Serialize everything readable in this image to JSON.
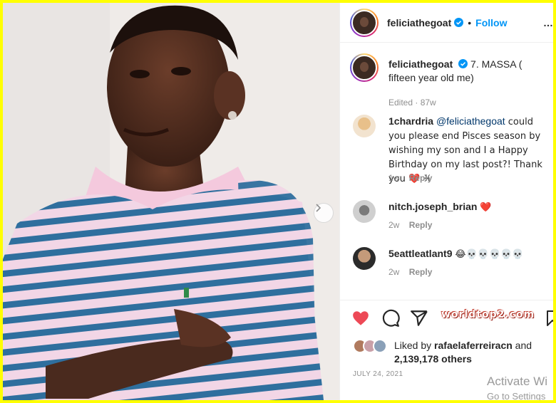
{
  "post": {
    "username": "feliciathegoat",
    "follow_label": "Follow",
    "more_label": "…",
    "caption_text": "7. MASSA ( fifteen year old me)",
    "caption_meta": "Edited · 87w"
  },
  "comments": [
    {
      "user": "1chardria",
      "mention": "@feliciathegoat",
      "text": " could you please end Pisces season by wishing my son and I a Happy Birthday on my last post?! Thank you ❤️ ♓",
      "age": "1w",
      "reply": "Reply"
    },
    {
      "user": "nitch.joseph_brian",
      "text": "❤️",
      "age": "2w",
      "reply": "Reply"
    },
    {
      "user": "5eattleatlant9",
      "text": "😂💀💀💀💀💀",
      "age": "2w",
      "reply": "Reply"
    }
  ],
  "likes": {
    "prefix": "Liked by ",
    "user": "rafaelaferreiracn",
    "suffix": " and",
    "count": "2,139,178 others"
  },
  "date": "JULY 24, 2021",
  "watermark": "worldtop2.com",
  "windows_notice": {
    "line1": "Activate Wi",
    "line2": "Go to Settings"
  },
  "icons": [
    "verified-badge-icon",
    "chevron-right-icon",
    "heart-icon",
    "comment-icon",
    "share-icon",
    "bookmark-icon"
  ],
  "colors": {
    "accent": "#0095f6",
    "like_red": "#ed4956",
    "frame": "#ffff00"
  }
}
